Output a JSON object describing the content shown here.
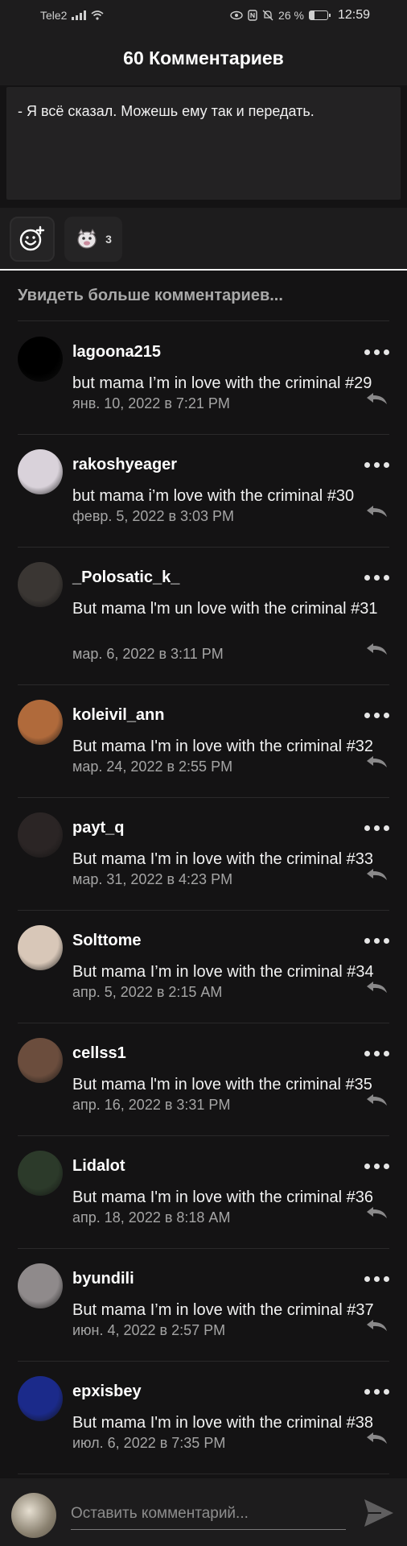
{
  "status": {
    "carrier": "Tele2",
    "battery": "26 %",
    "time": "12:59",
    "battery_level": 0.26
  },
  "header": {
    "title": "60 Комментариев"
  },
  "quote": {
    "text": "- Я всё сказал. Можешь ему так и передать."
  },
  "reactions": {
    "sticker_count": "3"
  },
  "see_more": "Увидеть больше комментариев...",
  "comments": [
    {
      "user": "lagoona215",
      "text": "but mama I’m in love with the criminal #29",
      "date": "янв. 10, 2022 в 7:21 PM",
      "avatar_color": "#000000"
    },
    {
      "user": "rakoshyeager",
      "text": "but mama i’m love with the criminal #30",
      "date": "февр. 5, 2022 в 3:03 PM",
      "avatar_color": "#d9d2da"
    },
    {
      "user": "_Polosatic_k_",
      "text": "But mama l'm un love with the criminal #31",
      "date": "мар. 6, 2022 в 3:11 PM",
      "avatar_color": "#3a3633"
    },
    {
      "user": "koleivil_ann",
      "text": "But mama I'm in love with the criminal #32",
      "date": "мар. 24, 2022 в 2:55 PM",
      "avatar_color": "#b06a3b"
    },
    {
      "user": "payt_q",
      "text": "But mama I'm in love with the criminal #33",
      "date": "мар. 31, 2022 в 4:23 PM",
      "avatar_color": "#2b2525"
    },
    {
      "user": "Solttome",
      "text": "But mama I’m in love with the criminal #34",
      "date": "апр. 5, 2022 в 2:15 AM",
      "avatar_color": "#d8c7b8"
    },
    {
      "user": "cellss1",
      "text": "But mama l'm in love with the criminal #35",
      "date": "апр. 16, 2022 в 3:31 PM",
      "avatar_color": "#6b4d3d"
    },
    {
      "user": "Lidalot",
      "text": "But mama I'm in love with the criminal #36",
      "date": "апр. 18, 2022 в 8:18 AM",
      "avatar_color": "#2c3a2a"
    },
    {
      "user": "byundili",
      "text": "But mama I’m in love with the criminal #37",
      "date": "июн. 4, 2022 в 2:57 PM",
      "avatar_color": "#8f8a8b"
    },
    {
      "user": "epxisbey",
      "text": "But mama I'm in love with the criminal #38",
      "date": "июл. 6, 2022 в 7:35 PM",
      "avatar_color": "#1b2a8a"
    }
  ],
  "composer": {
    "placeholder": "Оставить комментарий..."
  }
}
